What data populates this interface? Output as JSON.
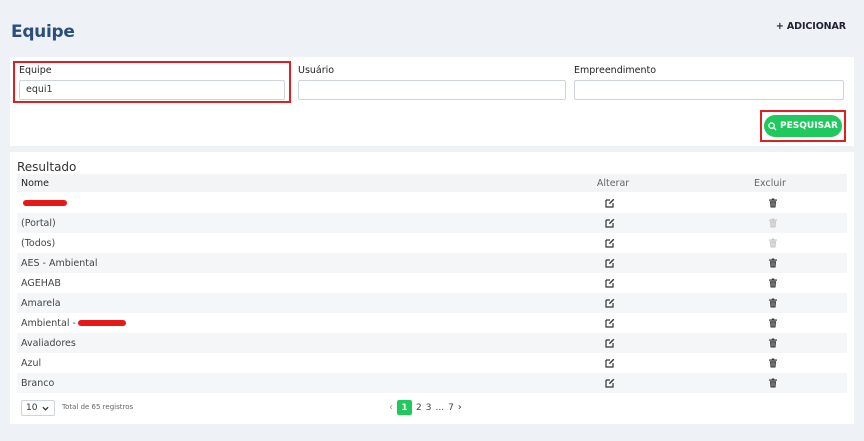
{
  "header": {
    "title": "Equipe",
    "add_label": "+ ADICIONAR"
  },
  "filters": {
    "equipe": {
      "label": "Equipe",
      "value": "equi1"
    },
    "usuario": {
      "label": "Usuário",
      "value": ""
    },
    "empreendimento": {
      "label": "Empreendimento",
      "value": ""
    },
    "search_label": "PESQUISAR"
  },
  "results": {
    "title": "Resultado",
    "columns": {
      "name": "Nome",
      "edit": "Alterar",
      "delete": "Excluir"
    },
    "rows": [
      {
        "name": "",
        "redacted": true,
        "delete_enabled": true
      },
      {
        "name": "(Portal)",
        "redacted": false,
        "delete_enabled": false
      },
      {
        "name": "(Todos)",
        "redacted": false,
        "delete_enabled": false
      },
      {
        "name": "AES - Ambiental",
        "redacted": false,
        "delete_enabled": true
      },
      {
        "name": "AGEHAB",
        "redacted": false,
        "delete_enabled": true
      },
      {
        "name": "Amarela",
        "redacted": false,
        "delete_enabled": true
      },
      {
        "name": "Ambiental -",
        "redacted": true,
        "delete_enabled": true
      },
      {
        "name": "Avaliadores",
        "redacted": false,
        "delete_enabled": true
      },
      {
        "name": "Azul",
        "redacted": false,
        "delete_enabled": true
      },
      {
        "name": "Branco",
        "redacted": false,
        "delete_enabled": true
      }
    ]
  },
  "footer": {
    "page_size": "10",
    "total_text": "Total de 65 registros",
    "pages": [
      "1",
      "2",
      "3",
      "...",
      "7"
    ],
    "current_page": "1"
  },
  "colors": {
    "accent": "#20c95e",
    "highlight": "#e02020",
    "title": "#2b4f7a"
  }
}
